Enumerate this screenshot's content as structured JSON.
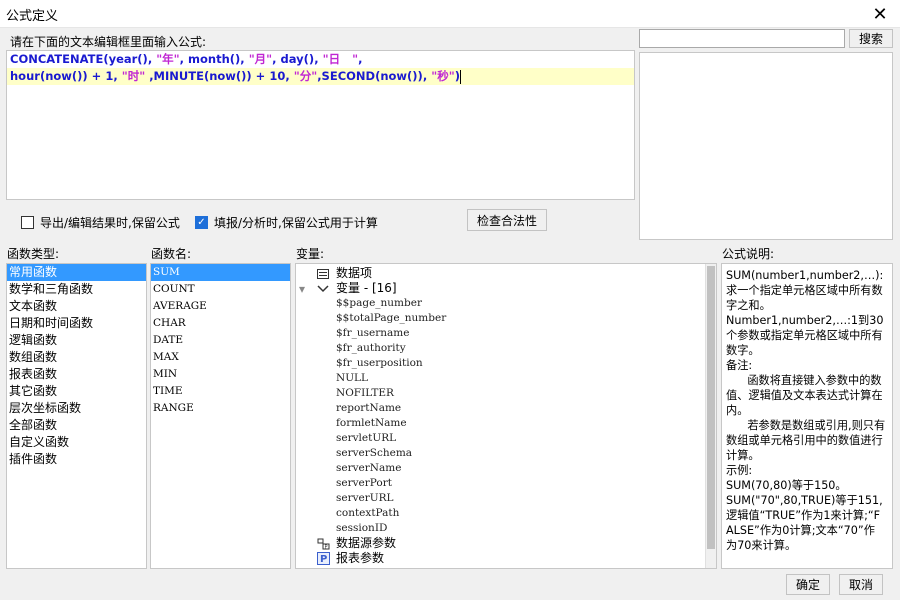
{
  "window": {
    "title": "公式定义",
    "close_icon": "close-icon"
  },
  "editor": {
    "prompt": "请在下面的文本编辑框里面输入公式:",
    "lines": [
      "CONCATENATE(year(), \"年\", month(), \"月\", day(), \"日   \",",
      "hour(now()) + 1, \"时\" ,MINUTE(now()) + 10, \"分\",SECOND(now()), \"秒\")"
    ]
  },
  "search": {
    "value": "",
    "placeholder": "",
    "button_label": "搜索"
  },
  "options": {
    "keep_formula_export": {
      "label": "导出/编辑结果时,保留公式",
      "checked": false
    },
    "keep_formula_fill": {
      "label": "填报/分析时,保留公式用于计算",
      "checked": true
    },
    "validate_label": "检查合法性"
  },
  "labels": {
    "function_types": "函数类型:",
    "function_names": "函数名:",
    "variables": "变量:",
    "description": "公式说明:"
  },
  "function_types": [
    "常用函数",
    "数学和三角函数",
    "文本函数",
    "日期和时间函数",
    "逻辑函数",
    "数组函数",
    "报表函数",
    "其它函数",
    "层次坐标函数",
    "全部函数",
    "自定义函数",
    "插件函数"
  ],
  "function_types_selected": 0,
  "function_names": [
    "SUM",
    "COUNT",
    "AVERAGE",
    "CHAR",
    "DATE",
    "MAX",
    "MIN",
    "TIME",
    "RANGE"
  ],
  "function_names_selected": 0,
  "variables": {
    "data_item": {
      "label": "数据项",
      "icon": "table-icon"
    },
    "var_group": {
      "label": "变量 - [16]",
      "icon": "variable-icon",
      "expand_icon": "chevron-down-icon"
    },
    "items": [
      "$$page_number",
      "$$totalPage_number",
      "$fr_username",
      "$fr_authority",
      "$fr_userposition",
      "NULL",
      "NOFILTER",
      "reportName",
      "formletName",
      "servletURL",
      "serverSchema",
      "serverName",
      "serverPort",
      "serverURL",
      "contextPath",
      "sessionID"
    ],
    "datasource_params": {
      "label": "数据源参数",
      "icon": "datasource-icon"
    },
    "report_params": {
      "label": "报表参数",
      "icon": "parameter-icon"
    }
  },
  "description": {
    "paragraphs": [
      "SUM(number1,number2,…): 求一个指定单元格区域中所有数字之和。",
      "Number1,number2,…:1到30个参数或指定单元格区域中所有数字。",
      "备注:",
      "      函数将直接键入参数中的数值、逻辑值及文本表达式计算在内。",
      "      若参数是数组或引用,则只有数组或单元格引用中的数值进行计算。",
      "示例:",
      "SUM(70,80)等于150。",
      "SUM(\"70\",80,TRUE)等于151,逻辑值“TRUE”作为1来计算;“FALSE”作为0计算;文本“70”作为70来计算。"
    ]
  },
  "footer": {
    "ok_label": "确定",
    "cancel_label": "取消"
  }
}
